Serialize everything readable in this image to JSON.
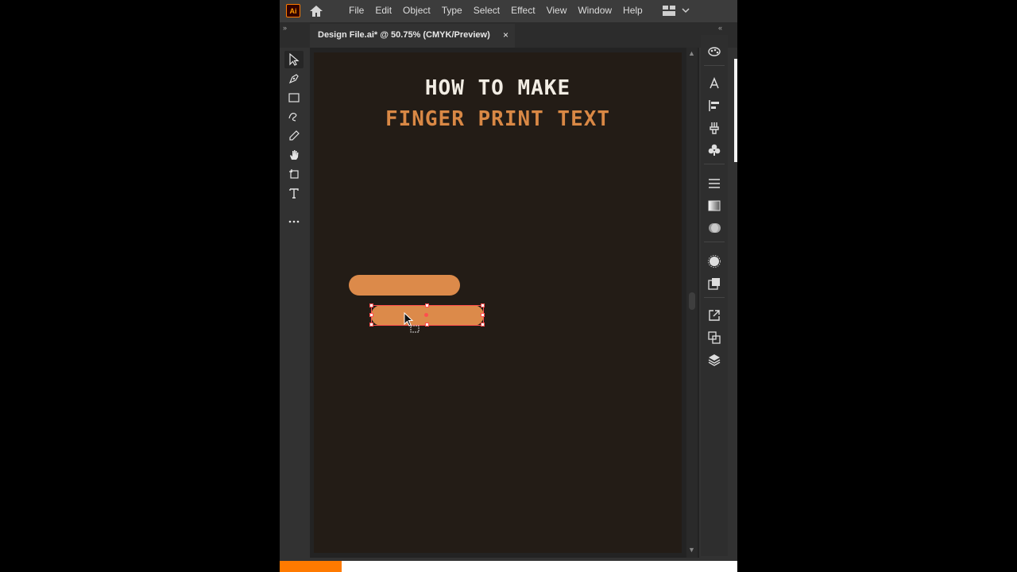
{
  "app": {
    "logo_text": "Ai",
    "brand_color": "#ff7c00"
  },
  "menu": {
    "items": [
      "File",
      "Edit",
      "Object",
      "Type",
      "Select",
      "Effect",
      "View",
      "Window",
      "Help"
    ]
  },
  "document": {
    "tab_title": "Design File.ai* @ 50.75% (CMYK/Preview)",
    "close_glyph": "×"
  },
  "tools": [
    "selection-tool-icon",
    "pen-tool-icon",
    "rectangle-tool-icon",
    "shaper-tool-icon",
    "eyedropper-tool-icon",
    "hand-tool-icon",
    "artboard-tool-icon",
    "type-tool-icon",
    "more-tools-icon"
  ],
  "artboard": {
    "headline_line1": "HOW TO MAKE",
    "headline_line2": "FINGER PRINT TEXT",
    "background_color": "#231c16",
    "shape_color": "#dc8a4a",
    "accent_text_color": "#d98845",
    "selection_color": "#ff4e4e"
  },
  "dock_icons": [
    "color-guide-icon",
    "character-icon",
    "align-icon",
    "brushes-icon",
    "symbols-icon",
    "stroke-icon",
    "gradient-icon",
    "transparency-icon",
    "appearance-icon",
    "graphic-styles-icon",
    "export-icon",
    "pathfinder-icon",
    "layers-icon"
  ],
  "progress": {
    "fraction": 0.135,
    "color": "#ff7a00"
  }
}
